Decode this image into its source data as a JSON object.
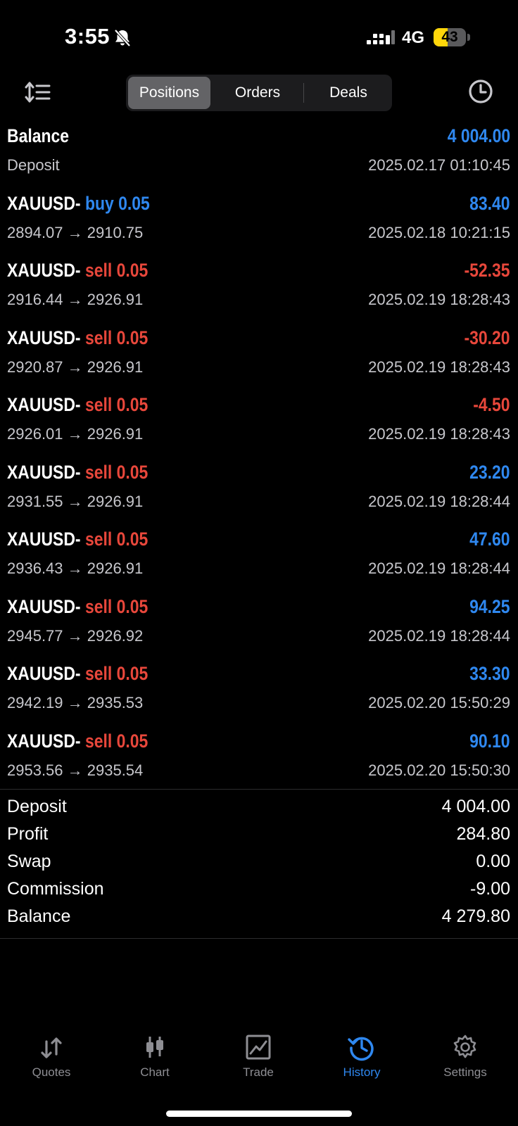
{
  "status_bar": {
    "time": "3:55",
    "network": "4G",
    "battery": "43",
    "battery_level": 0.43
  },
  "header": {
    "tabs": [
      {
        "label": "Positions",
        "active": true
      },
      {
        "label": "Orders",
        "active": false
      },
      {
        "label": "Deals",
        "active": false
      }
    ],
    "left_icon": "sort-icon",
    "right_icon": "clock-icon"
  },
  "colors": {
    "blue": "#2f88f0",
    "red": "#e8473b",
    "background": "#000000"
  },
  "balance_row": {
    "title": "Balance",
    "subtitle": "Deposit",
    "amount": "4 004.00",
    "time": "2025.02.17 01:10:45"
  },
  "positions": [
    {
      "symbol": "XAUUSD-",
      "side": "buy 0.05",
      "prices": "2894.07 → 2910.75",
      "profit": "83.40",
      "time": "2025.02.18 10:21:15"
    },
    {
      "symbol": "XAUUSD-",
      "side": "sell 0.05",
      "prices": "2916.44 → 2926.91",
      "profit": "-52.35",
      "time": "2025.02.19 18:28:43"
    },
    {
      "symbol": "XAUUSD-",
      "side": "sell 0.05",
      "prices": "2920.87 → 2926.91",
      "profit": "-30.20",
      "time": "2025.02.19 18:28:43"
    },
    {
      "symbol": "XAUUSD-",
      "side": "sell 0.05",
      "prices": "2926.01 → 2926.91",
      "profit": "-4.50",
      "time": "2025.02.19 18:28:43"
    },
    {
      "symbol": "XAUUSD-",
      "side": "sell 0.05",
      "prices": "2931.55 → 2926.91",
      "profit": "23.20",
      "time": "2025.02.19 18:28:44"
    },
    {
      "symbol": "XAUUSD-",
      "side": "sell 0.05",
      "prices": "2936.43 → 2926.91",
      "profit": "47.60",
      "time": "2025.02.19 18:28:44"
    },
    {
      "symbol": "XAUUSD-",
      "side": "sell 0.05",
      "prices": "2945.77 → 2926.92",
      "profit": "94.25",
      "time": "2025.02.19 18:28:44"
    },
    {
      "symbol": "XAUUSD-",
      "side": "sell 0.05",
      "prices": "2942.19 → 2935.53",
      "profit": "33.30",
      "time": "2025.02.20 15:50:29"
    },
    {
      "symbol": "XAUUSD-",
      "side": "sell 0.05",
      "prices": "2953.56 → 2935.54",
      "profit": "90.10",
      "time": "2025.02.20 15:50:30"
    }
  ],
  "summary": [
    {
      "label": "Deposit",
      "value": "4 004.00"
    },
    {
      "label": "Profit",
      "value": "284.80"
    },
    {
      "label": "Swap",
      "value": "0.00"
    },
    {
      "label": "Commission",
      "value": "-9.00"
    },
    {
      "label": "Balance",
      "value": "4 279.80"
    }
  ],
  "tabbar": [
    {
      "label": "Quotes",
      "icon": "quotes-icon",
      "active": false
    },
    {
      "label": "Chart",
      "icon": "chart-icon",
      "active": false
    },
    {
      "label": "Trade",
      "icon": "trade-icon",
      "active": false
    },
    {
      "label": "History",
      "icon": "history-icon",
      "active": true
    },
    {
      "label": "Settings",
      "icon": "settings-icon",
      "active": false
    }
  ]
}
